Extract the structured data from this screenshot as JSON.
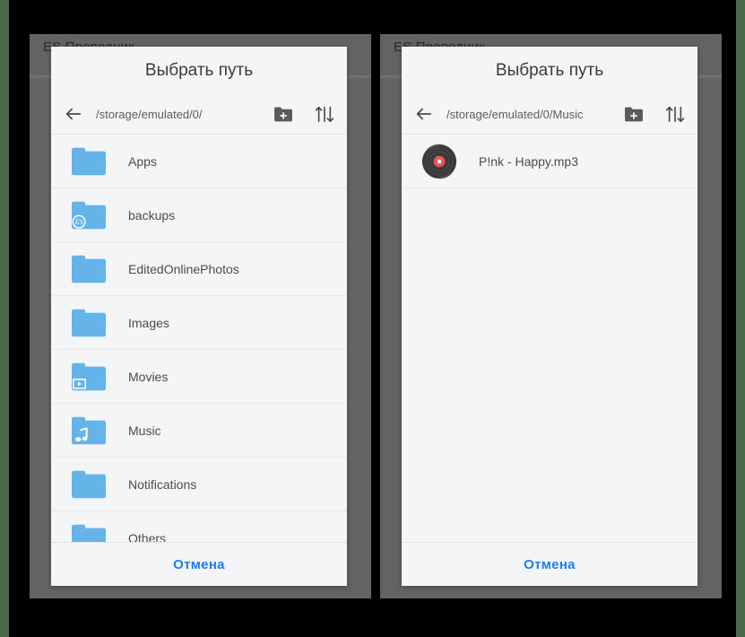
{
  "background": {
    "app_title": "ES Проводник",
    "colors": {
      "page": "#000000",
      "device": "#636363",
      "edge_accent": "#4a6b4a"
    }
  },
  "colors": {
    "dialog_bg": "#f4f5f6",
    "folder_blue": "#64b4ea",
    "accent_link": "#1e7bf0",
    "icon_gray": "#5a5a5a",
    "text_primary": "#3c3c3c",
    "text_secondary": "#5c5c5c",
    "vinyl_dark": "#3a3a3a",
    "vinyl_label": "#e8565a"
  },
  "panels": [
    {
      "id": "left",
      "dialog": {
        "title": "Выбрать путь",
        "pathbar": {
          "back_icon": "arrow-left-icon",
          "path": "/storage/emulated/0/",
          "new_folder_icon": "new-folder-icon",
          "sort_icon": "sort-icon"
        },
        "items": [
          {
            "name": "Apps",
            "icon": "folder-icon"
          },
          {
            "name": "backups",
            "icon": "folder-es-badge-icon"
          },
          {
            "name": "EditedOnlinePhotos",
            "icon": "folder-icon"
          },
          {
            "name": "Images",
            "icon": "folder-icon"
          },
          {
            "name": "Movies",
            "icon": "folder-video-icon"
          },
          {
            "name": "Music",
            "icon": "folder-music-icon"
          },
          {
            "name": "Notifications",
            "icon": "folder-icon"
          },
          {
            "name": "Others",
            "icon": "folder-icon"
          }
        ],
        "cancel_label": "Отмена"
      }
    },
    {
      "id": "right",
      "dialog": {
        "title": "Выбрать путь",
        "pathbar": {
          "back_icon": "arrow-left-icon",
          "path": "/storage/emulated/0/Music",
          "new_folder_icon": "new-folder-icon",
          "sort_icon": "sort-icon"
        },
        "items": [
          {
            "name": "P!nk - Happy.mp3",
            "icon": "vinyl-record-icon"
          }
        ],
        "cancel_label": "Отмена"
      }
    }
  ]
}
